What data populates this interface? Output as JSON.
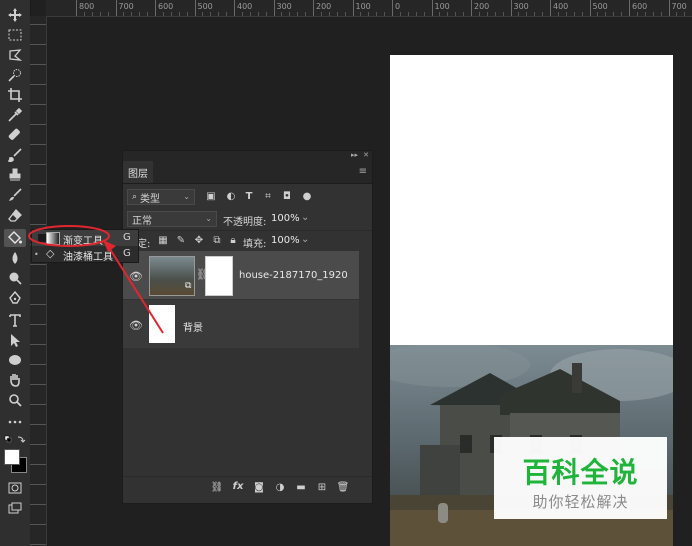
{
  "ruler": {
    "top_labels": [
      "800",
      "700",
      "600",
      "500",
      "400",
      "300",
      "200",
      "100",
      "0",
      "100",
      "200",
      "300",
      "400",
      "500",
      "600",
      "700"
    ]
  },
  "tools": [
    {
      "name": "move-tool-icon"
    },
    {
      "name": "marquee-tool-icon"
    },
    {
      "name": "lasso-tool-icon"
    },
    {
      "name": "quick-select-tool-icon"
    },
    {
      "name": "crop-tool-icon"
    },
    {
      "name": "eyedropper-tool-icon"
    },
    {
      "name": "healing-brush-tool-icon"
    },
    {
      "name": "brush-tool-icon"
    },
    {
      "name": "clone-stamp-tool-icon"
    },
    {
      "name": "history-brush-tool-icon"
    },
    {
      "name": "eraser-tool-icon"
    },
    {
      "name": "paint-bucket-tool-icon"
    },
    {
      "name": "blur-tool-icon"
    },
    {
      "name": "dodge-tool-icon"
    },
    {
      "name": "pen-tool-icon"
    },
    {
      "name": "type-tool-icon"
    },
    {
      "name": "path-select-tool-icon"
    },
    {
      "name": "ellipse-tool-icon"
    },
    {
      "name": "hand-tool-icon"
    },
    {
      "name": "zoom-tool-icon"
    },
    {
      "name": "more-tools-icon"
    }
  ],
  "tool_popup": {
    "items": [
      {
        "label": "渐变工具",
        "shortcut": "G",
        "selected": true
      },
      {
        "label": "油漆桶工具",
        "shortcut": "G",
        "selected": false
      }
    ]
  },
  "layers_panel": {
    "tab_label": "图层",
    "filter_label": "类型",
    "blend_mode": "正常",
    "opacity_label": "不透明度:",
    "opacity_value": "100%",
    "lock_label": "锁定:",
    "fill_label": "填充:",
    "fill_value": "100%",
    "layers": [
      {
        "name": "house-2187170_1920",
        "visible": true,
        "selected": true
      },
      {
        "name": "背景",
        "visible": true,
        "selected": false
      }
    ]
  },
  "watermark": {
    "title": "百科全说",
    "subtitle": "助你轻松解决"
  },
  "colors": {
    "annotation_red": "#e0262e",
    "watermark_green": "#1fb43a"
  }
}
